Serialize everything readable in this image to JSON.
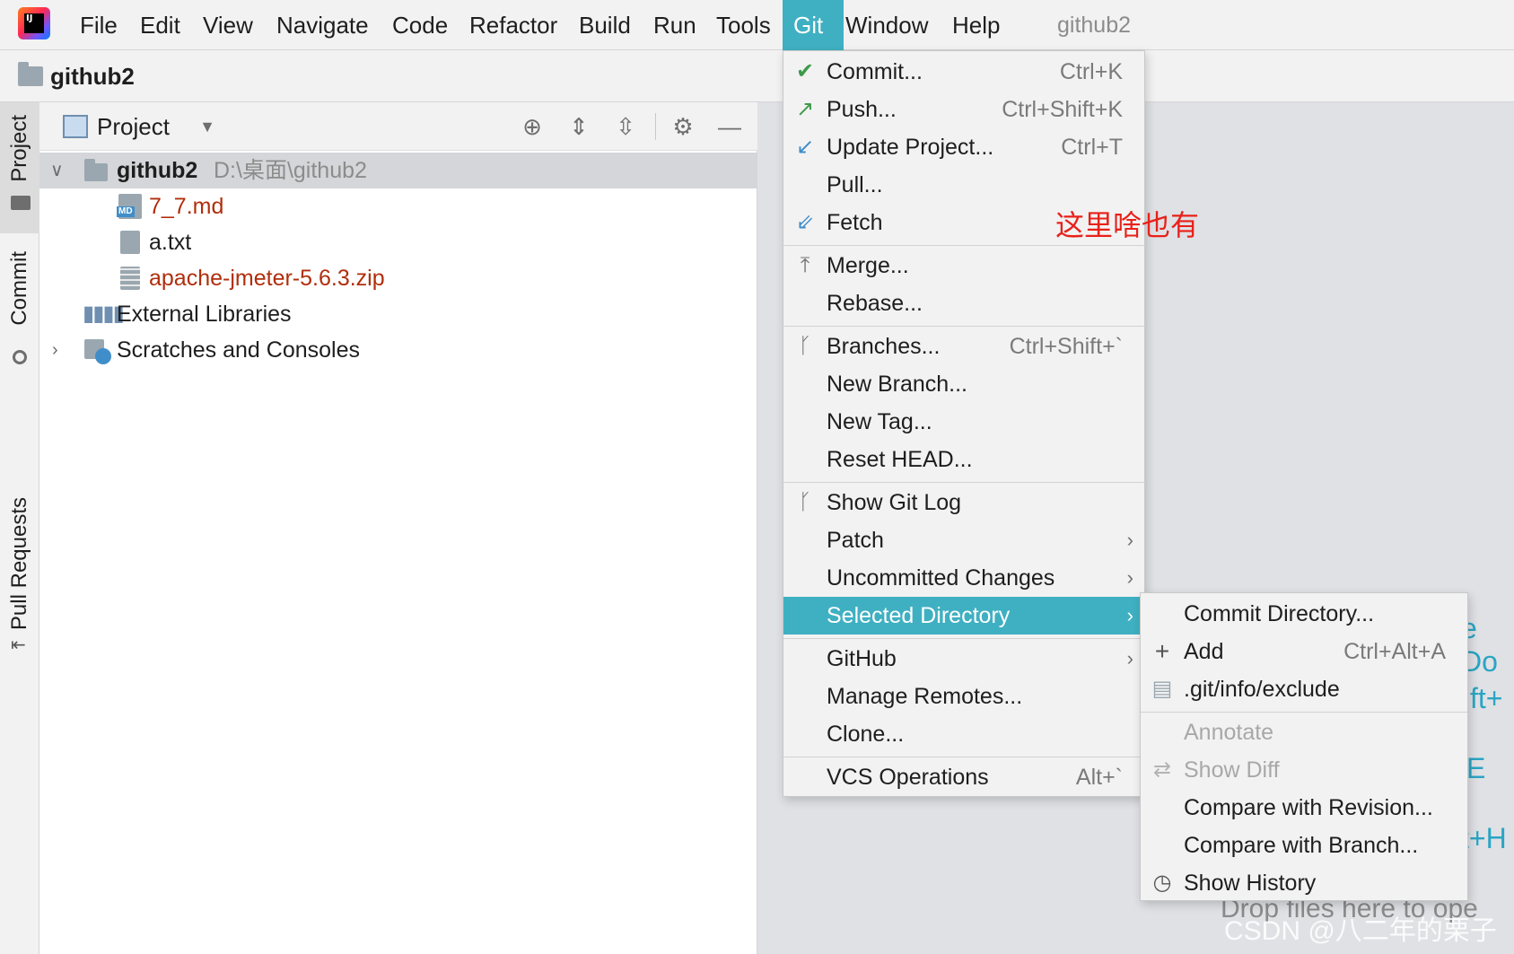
{
  "menubar": {
    "items": [
      "File",
      "Edit",
      "View",
      "Navigate",
      "Code",
      "Refactor",
      "Build",
      "Run",
      "Tools",
      "Git",
      "Window",
      "Help"
    ],
    "active": "Git",
    "project_name": "github2"
  },
  "navbar": {
    "title": "github2"
  },
  "stripe": {
    "tabs": [
      "Project",
      "Commit",
      "Pull Requests"
    ]
  },
  "project_panel": {
    "title": "Project",
    "tree": [
      {
        "name": "github2",
        "path": "D:\\桌面\\github2"
      },
      {
        "name": "7_7.md",
        "badge": "MD"
      },
      {
        "name": "a.txt"
      },
      {
        "name": "apache-jmeter-5.6.3.zip"
      },
      {
        "name": "External Libraries"
      },
      {
        "name": "Scratches and Consoles"
      }
    ]
  },
  "git_menu": {
    "items": [
      {
        "label": "Commit...",
        "shortcut": "Ctrl+K"
      },
      {
        "label": "Push...",
        "shortcut": "Ctrl+Shift+K"
      },
      {
        "label": "Update Project...",
        "shortcut": "Ctrl+T"
      },
      {
        "label": "Pull..."
      },
      {
        "label": "Fetch"
      },
      {
        "label": "Merge..."
      },
      {
        "label": "Rebase..."
      },
      {
        "label": "Branches...",
        "shortcut": "Ctrl+Shift+`"
      },
      {
        "label": "New Branch..."
      },
      {
        "label": "New Tag..."
      },
      {
        "label": "Reset HEAD..."
      },
      {
        "label": "Show Git Log"
      },
      {
        "label": "Patch"
      },
      {
        "label": "Uncommitted Changes"
      },
      {
        "label": "Selected Directory"
      },
      {
        "label": "GitHub"
      },
      {
        "label": "Manage Remotes..."
      },
      {
        "label": "Clone..."
      },
      {
        "label": "VCS Operations",
        "shortcut": "Alt+`"
      }
    ]
  },
  "submenu": {
    "items": [
      {
        "label": "Commit Directory..."
      },
      {
        "label": "Add",
        "shortcut": "Ctrl+Alt+A"
      },
      {
        "label": ".git/info/exclude"
      },
      {
        "label": "Annotate"
      },
      {
        "label": "Show Diff"
      },
      {
        "label": "Compare with Revision..."
      },
      {
        "label": "Compare with Branch..."
      },
      {
        "label": "Show History"
      }
    ]
  },
  "annotation": "这里啥也有",
  "editor": {
    "partial_texts": [
      "e Do",
      "ft+",
      "E",
      "t+H"
    ],
    "drop_hint": "Drop files here to ope",
    "watermark": "CSDN @八二年的栗子"
  },
  "colors": {
    "accent": "#3fb0c2",
    "annotation": "#e8211a",
    "modified_file": "#b02e0c",
    "editor_link": "#2aa5c4"
  }
}
